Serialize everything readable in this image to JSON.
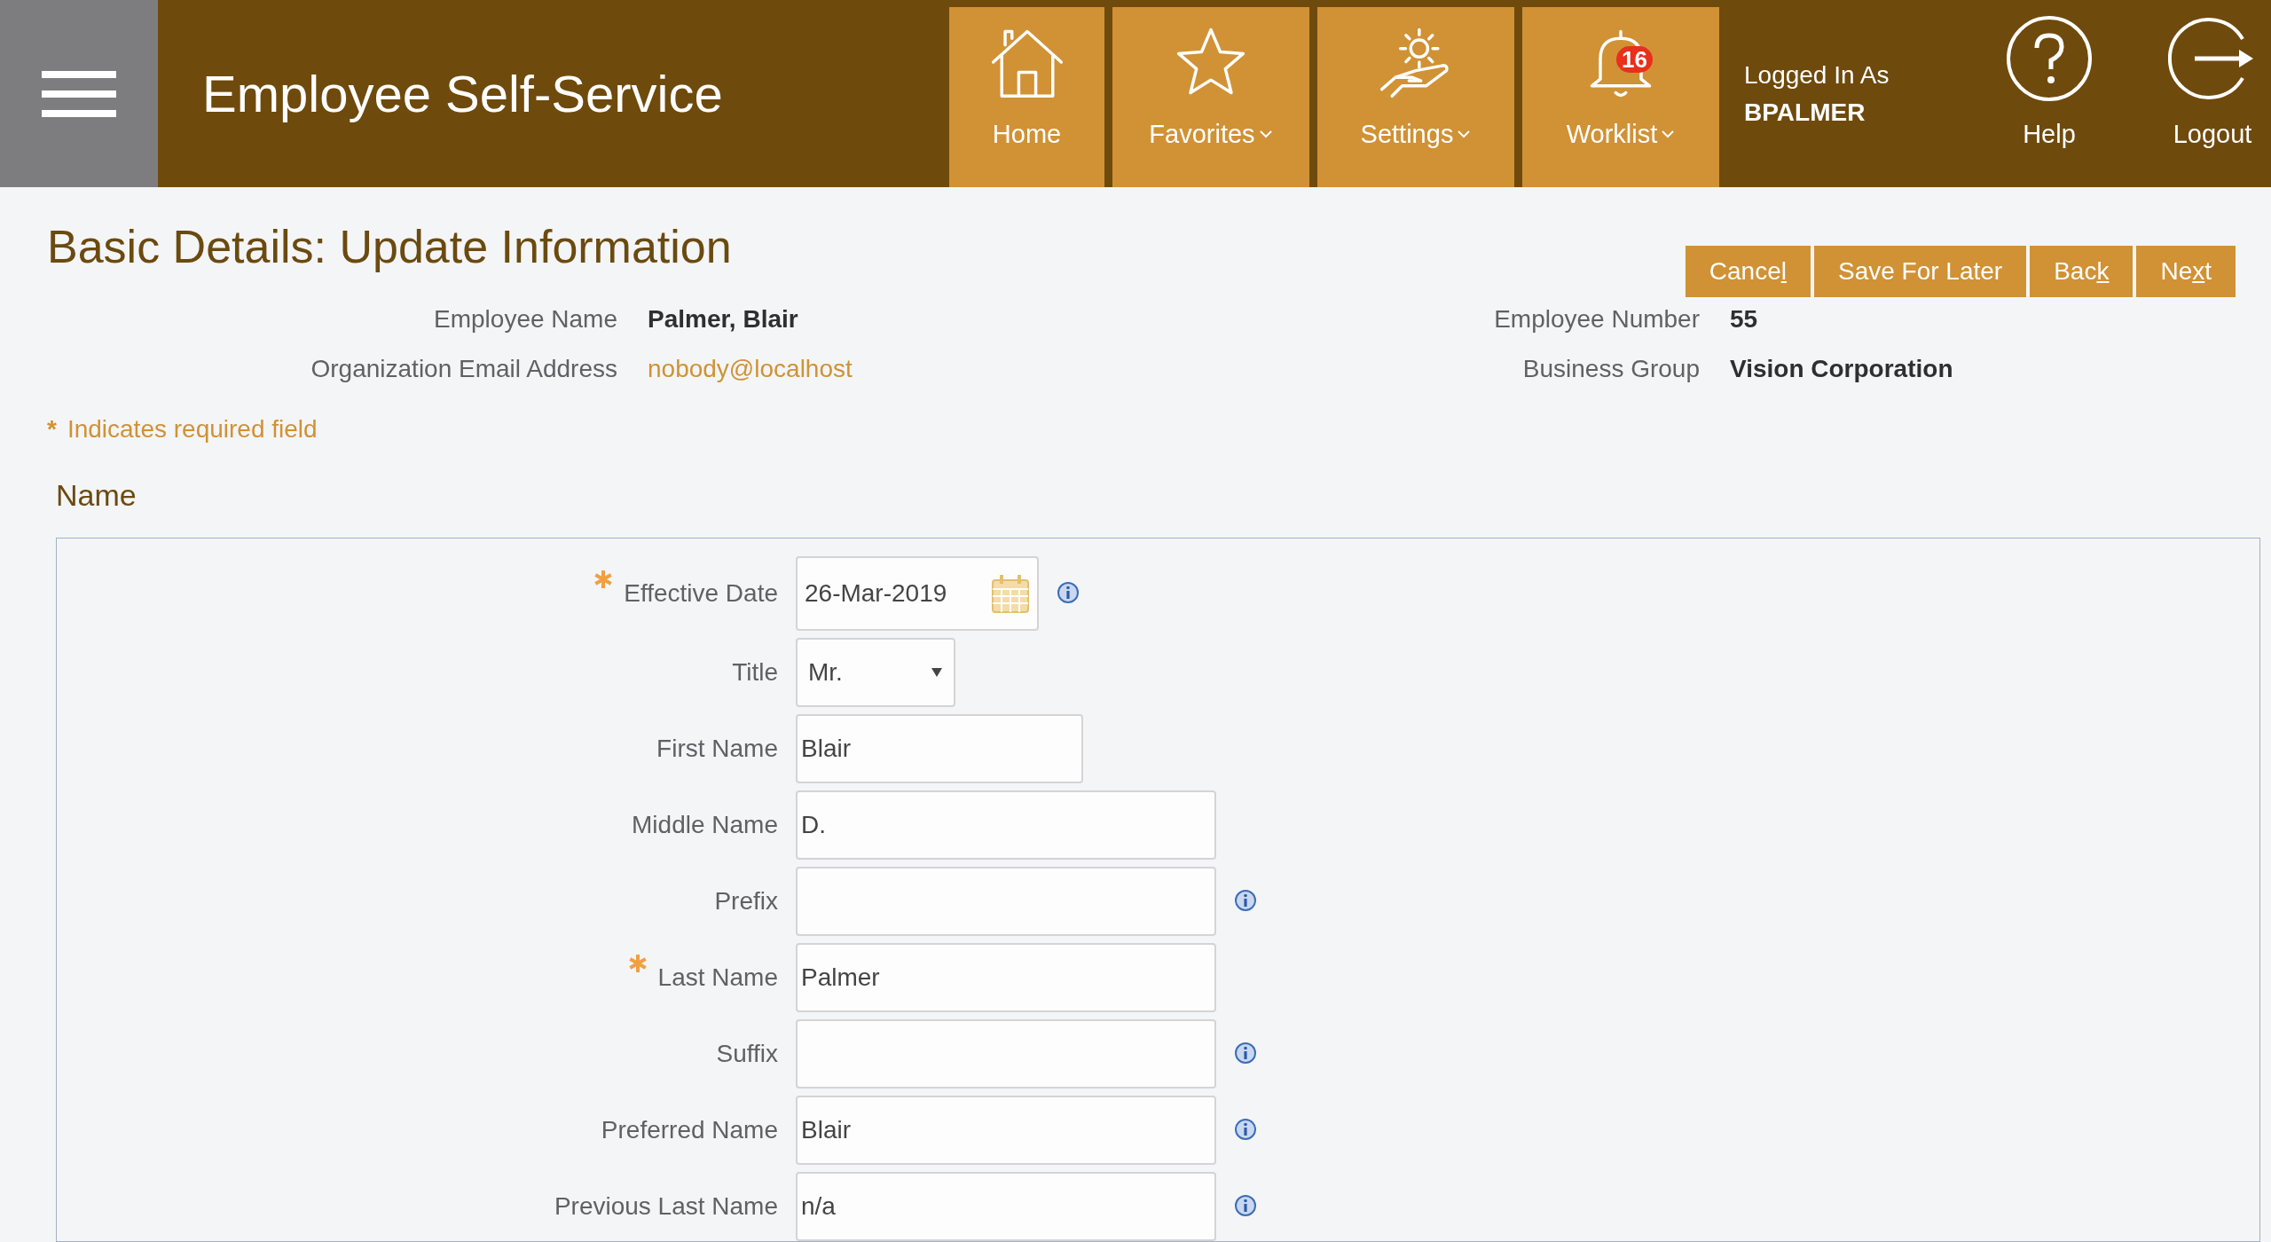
{
  "header": {
    "app_title": "Employee Self-Service",
    "nav": [
      {
        "label": "Home",
        "has_menu": false
      },
      {
        "label": "Favorites",
        "has_menu": true
      },
      {
        "label": "Settings",
        "has_menu": true
      },
      {
        "label": "Worklist",
        "has_menu": true,
        "badge": "16"
      }
    ],
    "user": {
      "caption": "Logged In As",
      "name": "BPALMER"
    },
    "actions": [
      {
        "label": "Help"
      },
      {
        "label": "Logout"
      }
    ]
  },
  "page": {
    "title": "Basic Details: Update Information",
    "buttons": [
      {
        "before": "Cance",
        "key": "l"
      },
      {
        "before": "Save For Later"
      },
      {
        "before": "Bac",
        "key": "k"
      },
      {
        "before": "Ne",
        "key": "x",
        "after": "t"
      }
    ],
    "info_left": [
      {
        "label": "Employee Name",
        "value": "Palmer, Blair",
        "kind": "bold"
      },
      {
        "label": "Organization Email Address",
        "value": "nobody@localhost",
        "kind": "link"
      }
    ],
    "info_right": [
      {
        "label": "Employee Number",
        "value": "55",
        "kind": "bold"
      },
      {
        "label": "Business Group",
        "value": "Vision Corporation",
        "kind": "bold"
      }
    ],
    "required_note": {
      "mark": "*",
      "text": "Indicates required field"
    },
    "section": {
      "title": "Name",
      "fields": [
        {
          "label": "Effective Date",
          "required": true,
          "value": "26-Mar-2019",
          "kind": "date",
          "info": true
        },
        {
          "label": "Title",
          "required": false,
          "value": "Mr.",
          "kind": "select",
          "info": false
        },
        {
          "label": "First Name",
          "required": false,
          "value": "Blair",
          "kind": "medium",
          "info": false
        },
        {
          "label": "Middle Name",
          "required": false,
          "value": "D.",
          "kind": "long",
          "info": false
        },
        {
          "label": "Prefix",
          "required": false,
          "kind": "long",
          "info": true
        },
        {
          "label": "Last Name",
          "required": true,
          "value": "Palmer",
          "kind": "long",
          "info": false
        },
        {
          "label": "Suffix",
          "required": false,
          "kind": "long",
          "info": true
        },
        {
          "label": "Preferred Name",
          "required": false,
          "value": "Blair",
          "kind": "long",
          "info": true
        },
        {
          "label": "Previous Last Name",
          "required": false,
          "value": "n/a",
          "kind": "long",
          "info": true
        }
      ]
    }
  }
}
